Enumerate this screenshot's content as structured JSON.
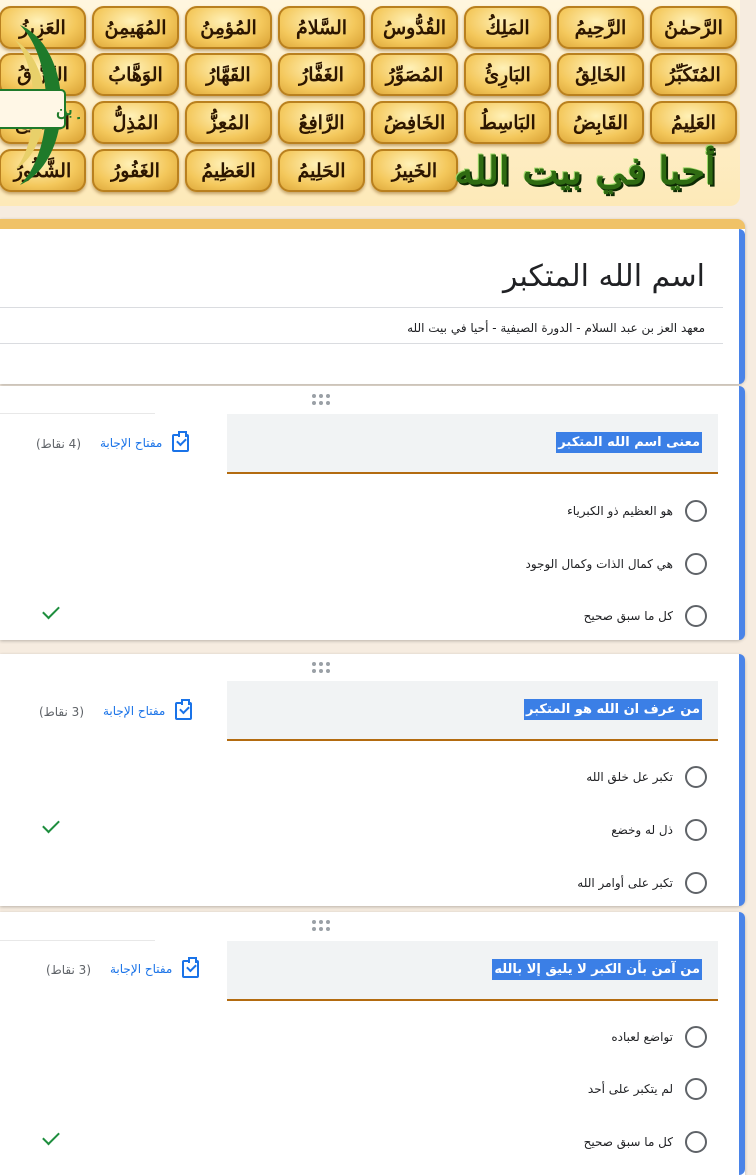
{
  "banner": {
    "names_row1": [
      "الرَّحمٰنُ",
      "الرَّحِيمُ",
      "المَلِكُ",
      "القُدُّوسُ",
      "السَّلامُ",
      "المُؤمِنُ",
      "المُهَيمِنُ",
      "العَزِيزُ"
    ],
    "names_row2": [
      "المُتَكَبِّرُ",
      "الخَالِقُ",
      "البَارِئُ",
      "المُصَوِّرُ",
      "الغَفَّارُ",
      "القَهَّارُ",
      "الوَهَّابُ",
      "الرَّزَّاقُ"
    ],
    "names_row3": [
      "العَلِيمُ",
      "القَابِضُ",
      "البَاسِطُ",
      "الخَافِضُ",
      "الرَّافِعُ",
      "المُعِزُّ",
      "المُذِلُّ",
      "السَّمِيعُ"
    ],
    "names_row4": [
      "الخَبِيرُ",
      "الحَلِيمُ",
      "العَظِيمُ",
      "الغَفُورُ",
      "الشَّكُورُ"
    ],
    "logo_text": "أحيا في بيت الله",
    "emblem_text": "العز بن"
  },
  "form": {
    "title": "اسم الله المتكبر",
    "description": "معهد العز بن عبد السلام - الدورة الصيفية - أحيا في بيت الله"
  },
  "answer_key_label": "مفتاح الإجابة",
  "questions": [
    {
      "text": "معنى اسم الله المتكبر",
      "points": "(4 نقاط)",
      "options": [
        "هو العظيم ذو الكبرياء",
        "هي كمال الذات وكمال الوجود",
        "كل ما سبق صحيح"
      ]
    },
    {
      "text": "من عرف ان الله هو المتكبر",
      "points": "(3 نقاط)",
      "options": [
        "تكبر عل خلق الله",
        "ذل له وخضع",
        "تكبر على أوامر  الله"
      ]
    },
    {
      "text": "من آمن بأن  الكبر لا يليق إلا بالله",
      "points": "(3 نقاط)",
      "options": [
        "تواضع لعباده",
        "لم يتكبر على أحد",
        "كل ما سبق صحيح"
      ]
    }
  ],
  "colors": {
    "accent_blue": "#4a84e8",
    "highlight": "#3b7fe6",
    "question_underline": "#b36b10",
    "correct_check": "#1e8e3e",
    "header_top": "#f0c267"
  }
}
